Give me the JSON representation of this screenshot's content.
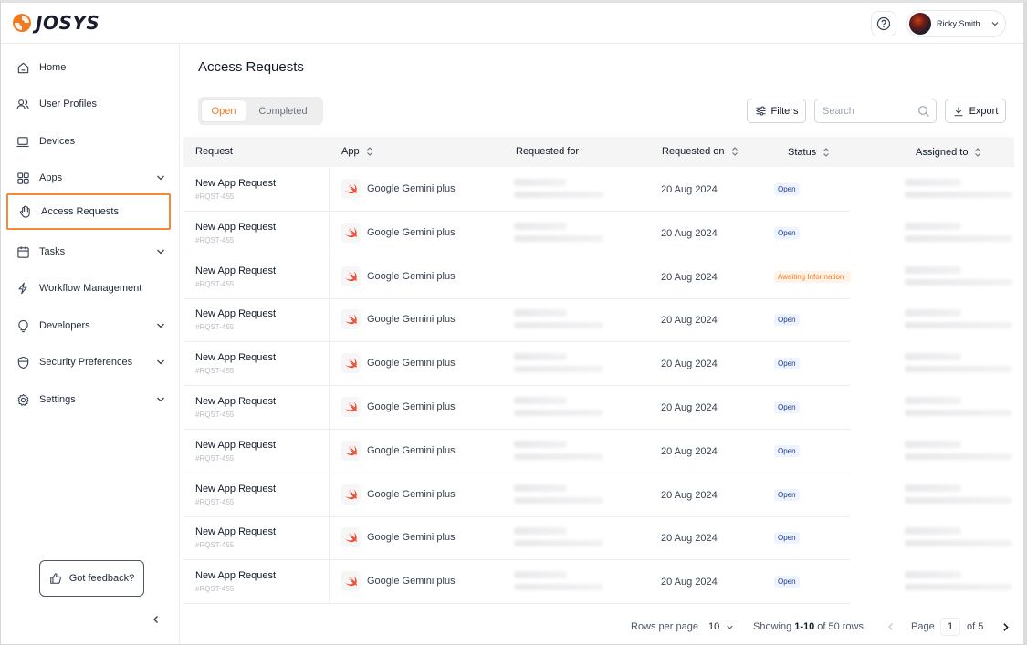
{
  "brand": {
    "logo_text": "JOSYS"
  },
  "header": {
    "user_name": "Ricky Smith"
  },
  "sidebar": {
    "items": [
      {
        "label": "Home",
        "icon": "home-icon"
      },
      {
        "label": "User Profiles",
        "icon": "users-icon"
      },
      {
        "label": "Devices",
        "icon": "laptop-icon"
      },
      {
        "label": "Apps",
        "icon": "grid-icon"
      },
      {
        "label": "Access Requests",
        "icon": "hand-icon"
      },
      {
        "label": "Tasks",
        "icon": "calendar-icon"
      },
      {
        "label": "Workflow Management",
        "icon": "bolt-icon"
      },
      {
        "label": "Developers",
        "icon": "bulb-icon"
      },
      {
        "label": "Security Preferences",
        "icon": "shield-icon"
      },
      {
        "label": "Settings",
        "icon": "gear-icon"
      }
    ],
    "active": "Access Requests",
    "feedback_label": "Got feedback?"
  },
  "page": {
    "title": "Access Requests",
    "tabs": [
      "Open",
      "Completed"
    ],
    "active_tab": "Open",
    "filters_label": "Filters",
    "search_placeholder": "Search",
    "export_label": "Export"
  },
  "table": {
    "columns": [
      "Request",
      "App",
      "Requested for",
      "Requested on",
      "Status",
      "Assigned to"
    ],
    "rows": [
      {
        "title": "New App Request",
        "id": "#RQST-455",
        "app": "Google Gemini plus",
        "date": "20 Aug 2024",
        "status": "Open"
      },
      {
        "title": "New App Request",
        "id": "#RQST-455",
        "app": "Google Gemini plus",
        "date": "20 Aug 2024",
        "status": "Open"
      },
      {
        "title": "New App Request",
        "id": "#RQST-455",
        "app": "Google Gemini plus",
        "date": "20 Aug 2024",
        "status": "Awaiting Information"
      },
      {
        "title": "New App Request",
        "id": "#RQST-455",
        "app": "Google Gemini plus",
        "date": "20 Aug 2024",
        "status": "Open"
      },
      {
        "title": "New App Request",
        "id": "#RQST-455",
        "app": "Google Gemini plus",
        "date": "20 Aug 2024",
        "status": "Open"
      },
      {
        "title": "New App Request",
        "id": "#RQST-455",
        "app": "Google Gemini plus",
        "date": "20 Aug 2024",
        "status": "Open"
      },
      {
        "title": "New App Request",
        "id": "#RQST-455",
        "app": "Google Gemini plus",
        "date": "20 Aug 2024",
        "status": "Open"
      },
      {
        "title": "New App Request",
        "id": "#RQST-455",
        "app": "Google Gemini plus",
        "date": "20 Aug 2024",
        "status": "Open"
      },
      {
        "title": "New App Request",
        "id": "#RQST-455",
        "app": "Google Gemini plus",
        "date": "20 Aug 2024",
        "status": "Open"
      },
      {
        "title": "New App Request",
        "id": "#RQST-455",
        "app": "Google Gemini plus",
        "date": "20 Aug 2024",
        "status": "Open"
      }
    ]
  },
  "pagination": {
    "rows_per_page_label": "Rows per page",
    "rows_per_page": "10",
    "showing_prefix": "Showing",
    "showing_range": "1-10",
    "showing_suffix": "of 50 rows",
    "page_label": "Page",
    "page": "1",
    "of_pages": "of 5"
  },
  "colors": {
    "accent": "#f07a21",
    "open_badge_bg": "#eef4ff",
    "await_badge_bg": "#fff3ea"
  }
}
